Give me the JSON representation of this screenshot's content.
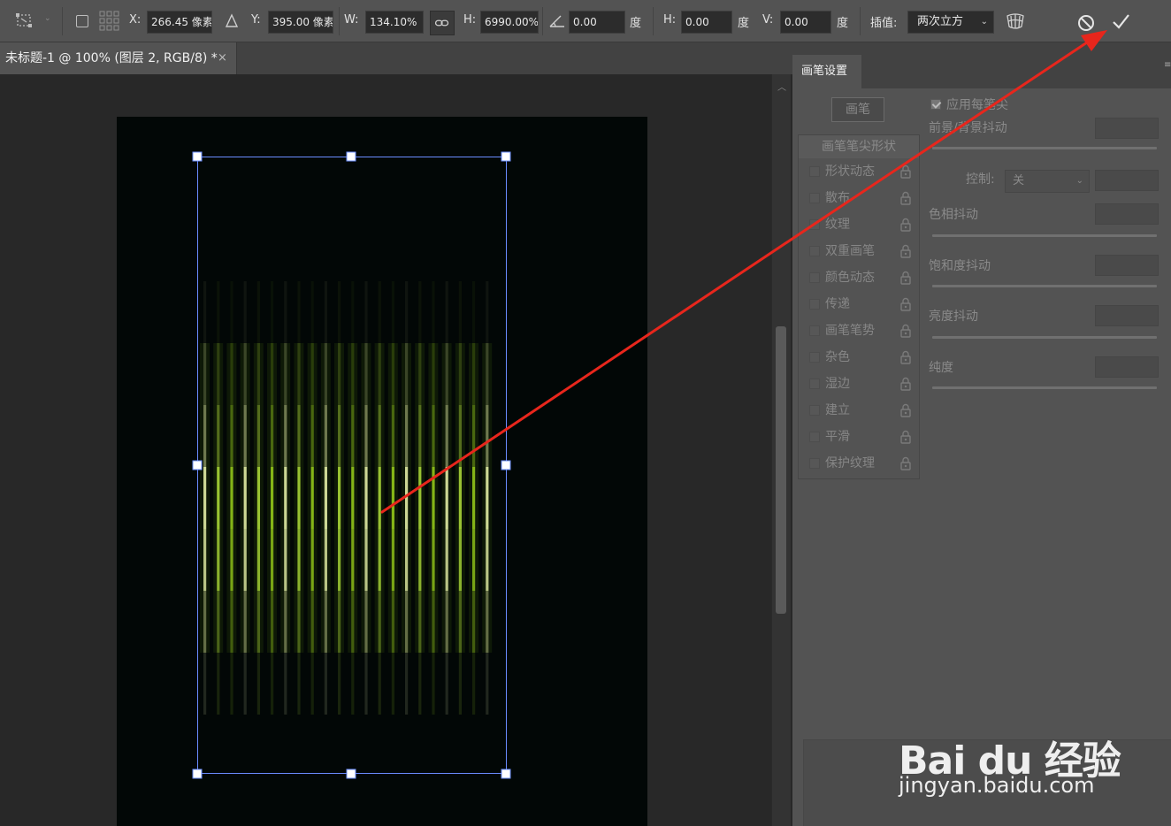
{
  "options_bar": {
    "x_label": "X:",
    "x_value": "266.45 像素",
    "y_label": "Y:",
    "y_value": "395.00 像素",
    "w_label": "W:",
    "w_value": "134.10%",
    "h_label": "H:",
    "h_value": "6990.00%",
    "angle_value": "0.00",
    "angle_unit": "度",
    "skew_h_label": "H:",
    "skew_h_value": "0.00",
    "skew_h_unit": "度",
    "skew_v_label": "V:",
    "skew_v_value": "0.00",
    "skew_v_unit": "度",
    "interp_label": "插值:",
    "interp_value": "两次立方",
    "icons": [
      "transform-icon",
      "reference-point-icon",
      "link-icon",
      "angle-icon",
      "warp-icon",
      "cancel-icon",
      "commit-icon"
    ]
  },
  "document": {
    "tab_title": "未标题-1 @ 100% (图层 2, RGB/8) *",
    "close_glyph": "×"
  },
  "panel": {
    "tab_label": "画笔设置",
    "brush_button": "画笔",
    "list_header": "画笔笔尖形状",
    "items": [
      "形状动态",
      "散布",
      "纹理",
      "双重画笔",
      "颜色动态",
      "传递",
      "画笔笔势",
      "杂色",
      "湿边",
      "建立",
      "平滑",
      "保护纹理"
    ],
    "apply_per_tip": "应用每笔尖",
    "fg_bg_jitter": "前景/背景抖动",
    "control_label": "控制:",
    "control_value": "关",
    "hue_jitter": "色相抖动",
    "saturation_jitter": "饱和度抖动",
    "brightness_jitter": "亮度抖动",
    "purity": "纯度"
  },
  "watermark": {
    "logo_text": "Bai du 经验",
    "url": "jingyan.baidu.com"
  },
  "colors": {
    "accent_arrow": "#e8261c",
    "selection": "#6a8cff",
    "stripe_green": "#9acd32"
  }
}
